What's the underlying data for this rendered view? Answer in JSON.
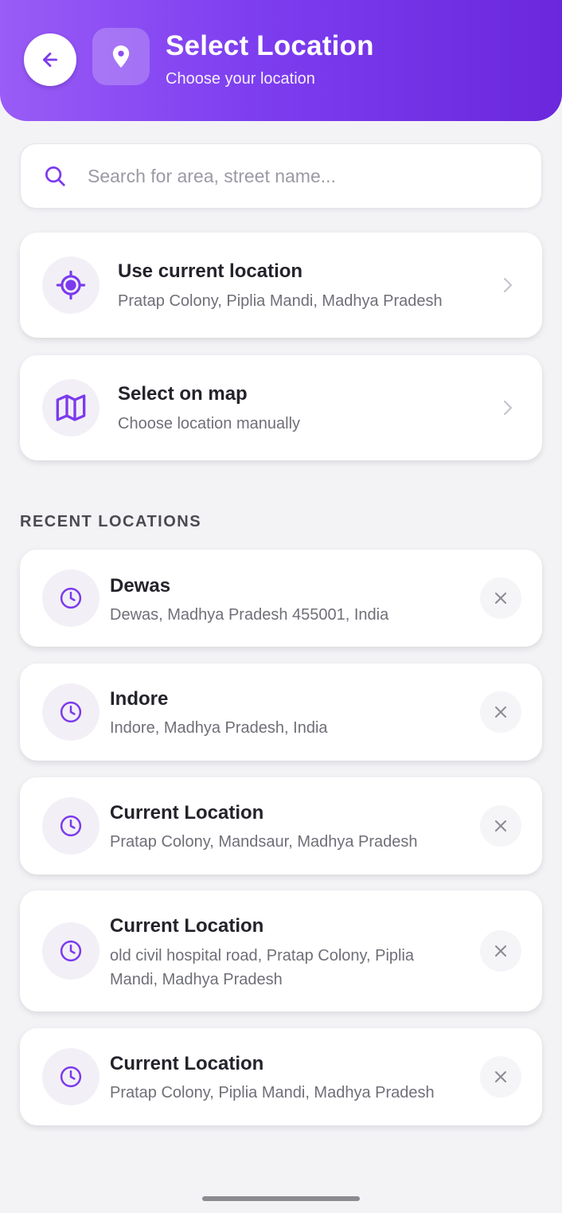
{
  "header": {
    "title": "Select Location",
    "subtitle": "Choose your location",
    "gradient": [
      "#9a5cf6",
      "#6b27db"
    ]
  },
  "search": {
    "placeholder": "Search for area, street name..."
  },
  "options": [
    {
      "title": "Use current location",
      "subtitle": "Pratap Colony, Piplia Mandi, Madhya Pradesh",
      "icon": "crosshair-icon"
    },
    {
      "title": "Select on map",
      "subtitle": "Choose location manually",
      "icon": "map-icon"
    }
  ],
  "recent": {
    "label": "RECENT LOCATIONS",
    "items": [
      {
        "title": "Dewas",
        "subtitle": "Dewas, Madhya Pradesh 455001, India"
      },
      {
        "title": "Indore",
        "subtitle": "Indore, Madhya Pradesh, India"
      },
      {
        "title": "Current Location",
        "subtitle": "Pratap Colony, Mandsaur, Madhya Pradesh"
      },
      {
        "title": "Current Location",
        "subtitle_line1": "old civil hospital road, Pratap Colony, Piplia",
        "subtitle_line2": "Mandi, Madhya Pradesh"
      },
      {
        "title": "Current Location",
        "subtitle": "Pratap Colony, Piplia Mandi, Madhya Pradesh"
      }
    ]
  },
  "colors": {
    "accent": "#7c3aed",
    "background": "#f3f3f6"
  }
}
